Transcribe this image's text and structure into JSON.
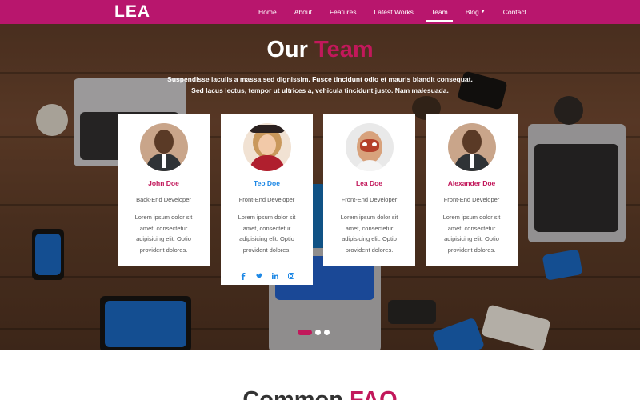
{
  "brand": "LEA",
  "nav": {
    "items": [
      {
        "label": "Home"
      },
      {
        "label": "About"
      },
      {
        "label": "Features"
      },
      {
        "label": "Latest Works"
      },
      {
        "label": "Team"
      },
      {
        "label": "Blog"
      },
      {
        "label": "Contact"
      }
    ],
    "active": "Team"
  },
  "hero": {
    "title_main": "Our",
    "title_accent": "Team",
    "text_line1": "Suspendisse iaculis a massa sed dignissim. Fusce tincidunt odio et mauris blandit consequat.",
    "text_line2": "Sed lacus lectus, tempor ut ultrices a, vehicula tincidunt justo. Nam malesuada."
  },
  "team": [
    {
      "name": "John Doe",
      "role": "Back-End Developer",
      "bio": "Lorem ipsum dolor sit amet, consectetur adipisicing elit. Optio provident dolores.",
      "name_color": "#c2185b"
    },
    {
      "name": "Teo Doe",
      "role": "Front-End Developer",
      "bio": "Lorem ipsum dolor sit amet, consectetur adipisicing elit. Optio provident dolores.",
      "name_color": "#1e88e5"
    },
    {
      "name": "Lea Doe",
      "role": "Front-End Developer",
      "bio": "Lorem ipsum dolor sit amet, consectetur adipisicing elit. Optio provident dolores.",
      "name_color": "#c2185b"
    },
    {
      "name": "Alexander Doe",
      "role": "Front-End Developer",
      "bio": "Lorem ipsum dolor sit amet, consectetur adipisicing elit. Optio provident dolores.",
      "name_color": "#c2185b"
    }
  ],
  "social_icons": [
    "facebook-icon",
    "twitter-icon",
    "linkedin-icon",
    "instagram-icon"
  ],
  "faq": {
    "title_main": "Common",
    "title_accent": "FAQ"
  },
  "colors": {
    "brand": "#b8166d",
    "accent": "#c2185b",
    "link_blue": "#1e88e5"
  }
}
